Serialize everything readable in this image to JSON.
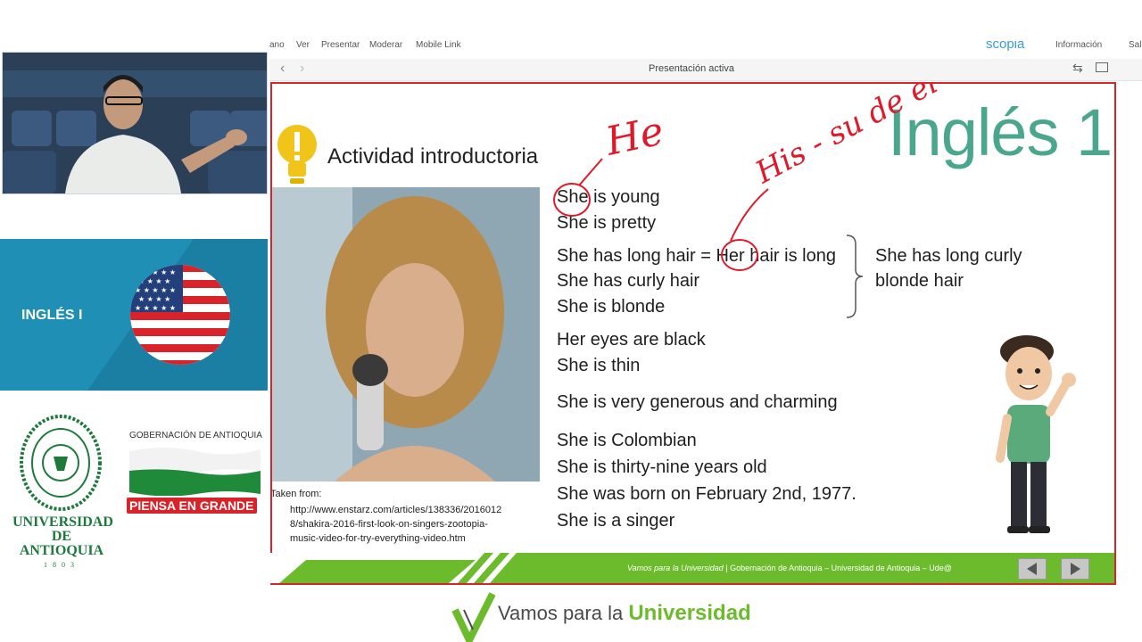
{
  "menu": {
    "items": [
      "ano",
      "Ver",
      "Presentar",
      "Moderar",
      "Mobile Link"
    ],
    "brand": "scopia",
    "info": "Información",
    "exit": "Salir"
  },
  "toolbar": {
    "title": "Presentación activa"
  },
  "sidebar": {
    "course": "INGLÉS I",
    "university_line1": "UNIVERSIDAD",
    "university_line2": "DE ANTIOQUIA",
    "university_year": "1803",
    "gov_title": "GOBERNACIÓN DE ANTIOQUIA",
    "gov_slogan": "PIENSA EN GRANDE"
  },
  "slide": {
    "activity_title": "Actividad introductoria",
    "course_title": "Inglés 1",
    "credit_label": "Taken from:",
    "credit_url_1": "http://www.enstarz.com/articles/138336/2016012",
    "credit_url_2": "8/shakira-2016-first-look-on-singers-zootopia-",
    "credit_url_3": "music-video-for-try-everything-video.htm",
    "lines": {
      "l1": "She is young",
      "l2": "She is pretty",
      "l3": "She has long hair = Her hair is long",
      "l4": "She has curly hair",
      "l5": "She is blonde",
      "summary1": "She has long curly",
      "summary2": "blonde hair",
      "l6": "Her eyes are black",
      "l7": "She is thin",
      "l8": "She is very generous and charming",
      "l9": "She is Colombian",
      "l10": "She is thirty-nine years old",
      "l11": "She was born on February 2nd, 1977.",
      "l12": "She is a singer"
    },
    "annotations": {
      "he": "He",
      "his": "His - su de él"
    },
    "footer_italic": "Vamos para la Universidad",
    "footer_rest": "| Gobernación de Antioquia – Universidad de Antioquia – Ude@"
  },
  "bottom_logo": {
    "prefix": "Vamos para la ",
    "strong": "Universidad"
  },
  "colors": {
    "accent_green": "#6cbb2c",
    "banner_blue": "#1f8fb5",
    "slide_border_red": "#d8232a",
    "title_teal": "#4aa68c"
  }
}
